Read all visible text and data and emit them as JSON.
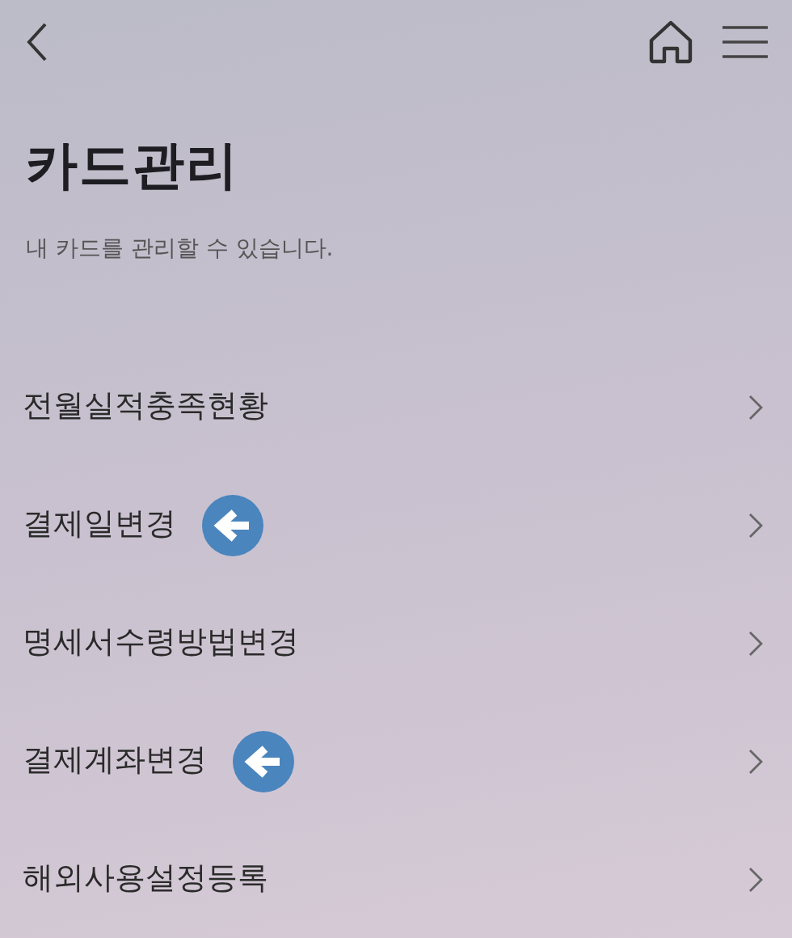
{
  "header": {
    "back": true,
    "home": true,
    "menu": true
  },
  "title": "카드관리",
  "subtitle": "내 카드를 관리할 수 있습니다.",
  "items": [
    {
      "label": "전월실적충족현황",
      "marked": false
    },
    {
      "label": "결제일변경",
      "marked": true
    },
    {
      "label": "명세서수령방법변경",
      "marked": false
    },
    {
      "label": "결제계좌변경",
      "marked": true
    },
    {
      "label": "해외사용설정등록",
      "marked": false
    }
  ]
}
